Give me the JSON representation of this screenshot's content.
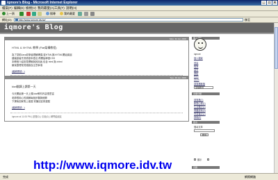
{
  "window": {
    "title": "iqmore's Blog - Microsoft Internet Explorer",
    "controls": [
      "_",
      "□",
      "×"
    ]
  },
  "menu": [
    "檔案(F)",
    "編輯(E)",
    "檢視(V)",
    "我的最愛(A)",
    "工具(T)",
    "說明(H)"
  ],
  "toolbar": {
    "back": "上一頁",
    "search": "搜尋",
    "favorites": "我的最愛"
  },
  "address": {
    "label": "網址(D)",
    "value": "http://www.iqmore.idv.tw/",
    "go": "移至"
  },
  "blog": {
    "title": "iqmore's Blog",
    "posts": [
      {
        "date": "Mon, 31 Jul, 2006",
        "title": "HTML & XHTML 教學 (Flat架構教程)",
        "lines": [
          "為了幫助Java初學者理解網頁,從HTML與XHTML開始講起",
          "建議讀者先熟悉基本語法,再開始學習CSS",
          "本教程介紹常見標籤與其用途,包含 html 與 xhtml",
          "最後整理常見錯誤及注意事項"
        ],
        "more": "(繼續閱讀...)",
        "footer": "iqmore at 06:01 PM | 迴響(0) | 引用(0) | 轉寄給朋友"
      },
      {
        "date": "Sun, 30 Jul, 2006",
        "title": "kiwi翻譯上讀第一天",
        "lines": [
          "今天開始第一天上課,kiwi教材內容很豐富",
          "老師很用心的講解每個步驟與細節",
          "下課後回家馬上複習,寫筆記記錄重點"
        ],
        "more": "(繼續閱讀...)",
        "footer": "iqmore at 11:05 PM | 迴響(0) | 引用(0) | 轉寄給朋友"
      }
    ],
    "sidebar": {
      "profile_head": "個人資料",
      "nickname": "iqmore",
      "profile_link": "個人檔案",
      "nav": [
        "首頁",
        "相簿",
        "留言",
        "連結",
        "RSS",
        "Atom",
        "部落格聯播"
      ],
      "categories_head": "文章分類",
      "categories": [
        "部落格(1)",
        "新聞心得(1)",
        "生活雜記(4)",
        "電腦技術(3)",
        "學習筆記(2)",
        "其他(0)"
      ],
      "search_head": "搜尋",
      "search_label": "搜尋文章",
      "search_button": "搜尋",
      "search_option": "全站搜尋",
      "calendar_head": "月曆",
      "checkbox_label": "顯示"
    }
  },
  "overlay_url": "http://www.iqmore.idv.tw",
  "status": {
    "left": "完成",
    "right": "網際網路"
  },
  "colors": {
    "header_bg": "#666666",
    "link": "#0000ee",
    "titlebar": "#0a246a"
  }
}
